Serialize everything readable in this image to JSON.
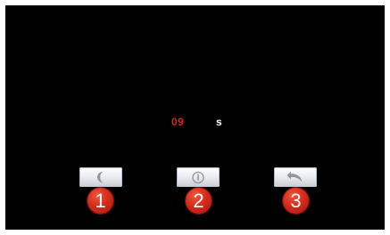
{
  "countdown": {
    "value": "09",
    "unit": "s"
  },
  "buttons": [
    {
      "icon": "moon-icon",
      "badge": "1"
    },
    {
      "icon": "power-icon",
      "badge": "2"
    },
    {
      "icon": "undo-icon",
      "badge": "3"
    }
  ],
  "colors": {
    "screen_background": "#000000",
    "countdown_value": "#d81e1e",
    "countdown_unit": "#ffffff",
    "badge": "#d42c1c"
  }
}
